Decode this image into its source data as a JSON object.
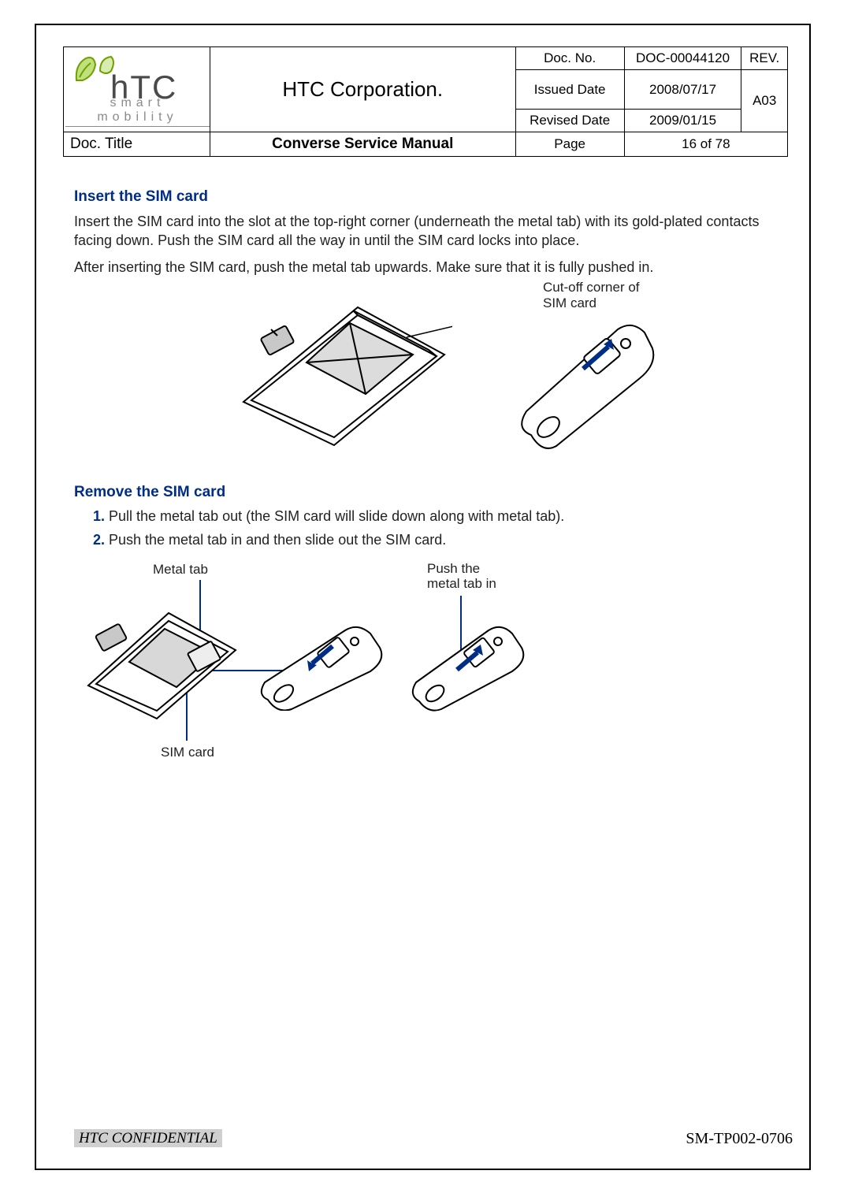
{
  "header": {
    "company": "HTC Corporation.",
    "logo_text": "hTC",
    "logo_sub": "smart mobility",
    "labels": {
      "doc_no": "Doc. No.",
      "issued": "Issued Date",
      "revised": "Revised Date",
      "rev": "REV.",
      "title": "Doc. Title",
      "page": "Page"
    },
    "values": {
      "doc_no": "DOC-00044120",
      "issued": "2008/07/17",
      "revised": "2009/01/15",
      "rev": "A03",
      "title": "Converse Service Manual",
      "page": "16  of  78"
    }
  },
  "section1": {
    "heading": "Insert the SIM card",
    "p1": "Insert the SIM card into the slot at the top-right corner (underneath the metal tab) with its gold-plated contacts facing down. Push the SIM card all the way in until the SIM card locks into place.",
    "p2": "After inserting the SIM card, push the metal tab upwards. Make sure that it is fully pushed in.",
    "caption_cutoff_l1": "Cut-off corner of",
    "caption_cutoff_l2": "SIM card"
  },
  "section2": {
    "heading": "Remove the SIM card",
    "steps": [
      "Pull the metal tab out (the SIM card will slide down along with metal tab).",
      "Push the metal tab in and then slide out the SIM card."
    ],
    "lbl_metal": "Metal tab",
    "lbl_push_l1": "Push the",
    "lbl_push_l2": "metal tab in",
    "lbl_sim": "SIM card"
  },
  "footer": {
    "confidential": "HTC CONFIDENTIAL",
    "code": "SM-TP002-0706"
  }
}
